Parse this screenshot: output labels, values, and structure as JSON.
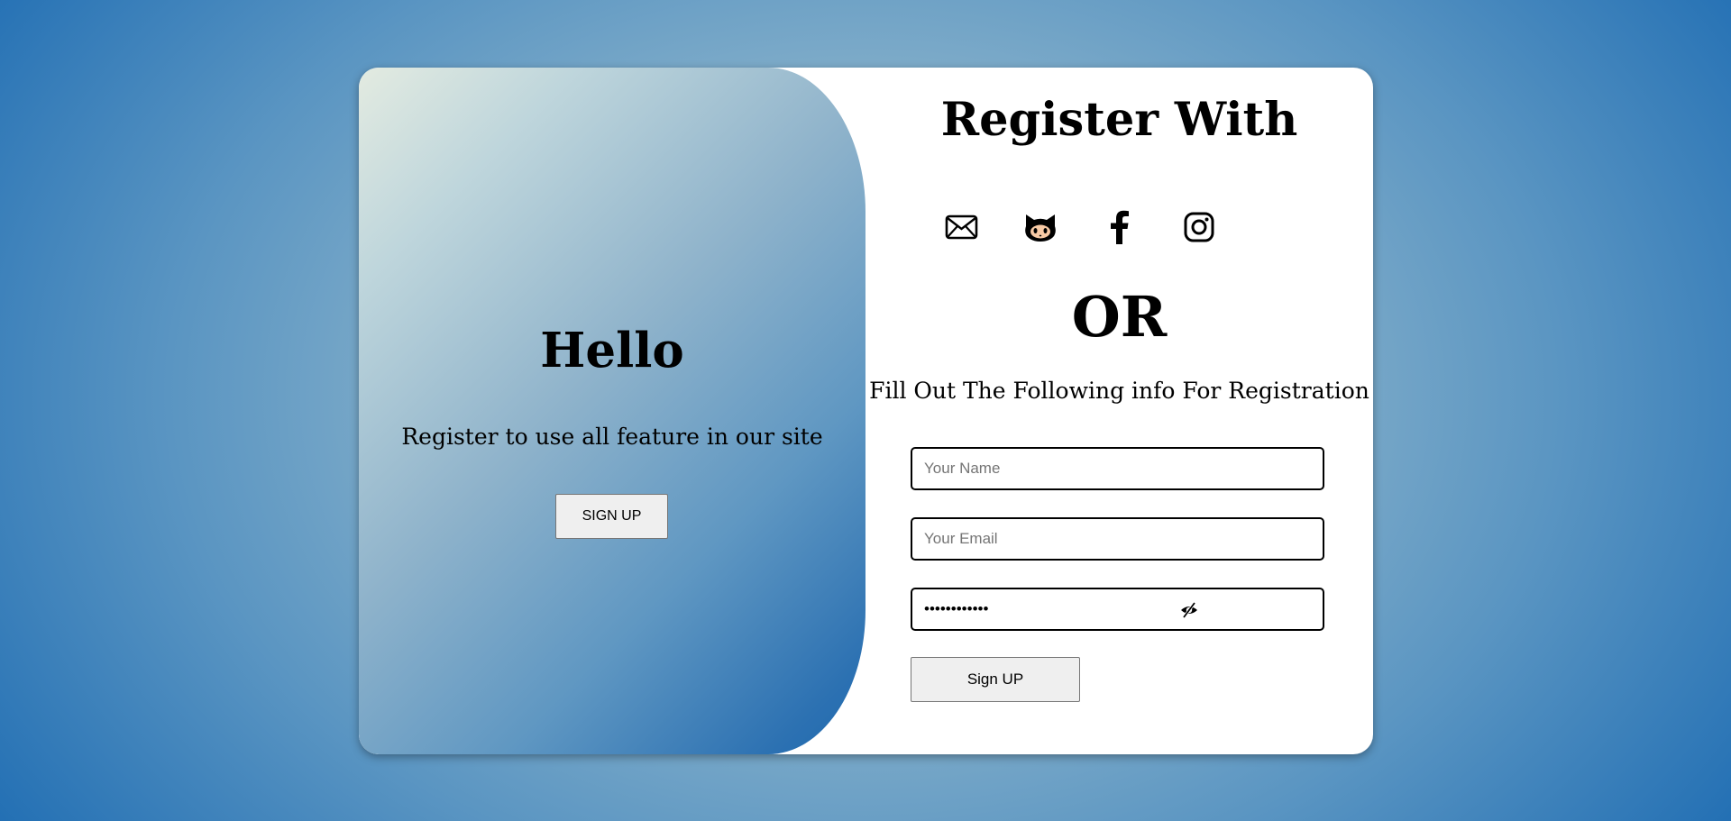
{
  "left_panel": {
    "heading": "Hello",
    "subtitle": "Register to use all feature in our site",
    "signup_button": "SIGN UP"
  },
  "right_panel": {
    "title": "Register With",
    "social_icons": [
      "envelope-icon",
      "github-icon",
      "facebook-icon",
      "instagram-icon"
    ],
    "or_text": "OR",
    "info_text": "Fill Out The Following info For Registration",
    "form": {
      "name_placeholder": "Your Name",
      "email_placeholder": "Your Email",
      "password_value": "••••••••••••",
      "password_toggle_icon": "eye-slash-icon",
      "submit_label": "Sign UP"
    }
  },
  "colors": {
    "background_edge": "#1f6db3",
    "background_center": "#a7c3d0",
    "panel_gradient_start": "#e3ebe1",
    "panel_gradient_end": "#1e69ae",
    "card_background": "#ffffff"
  }
}
